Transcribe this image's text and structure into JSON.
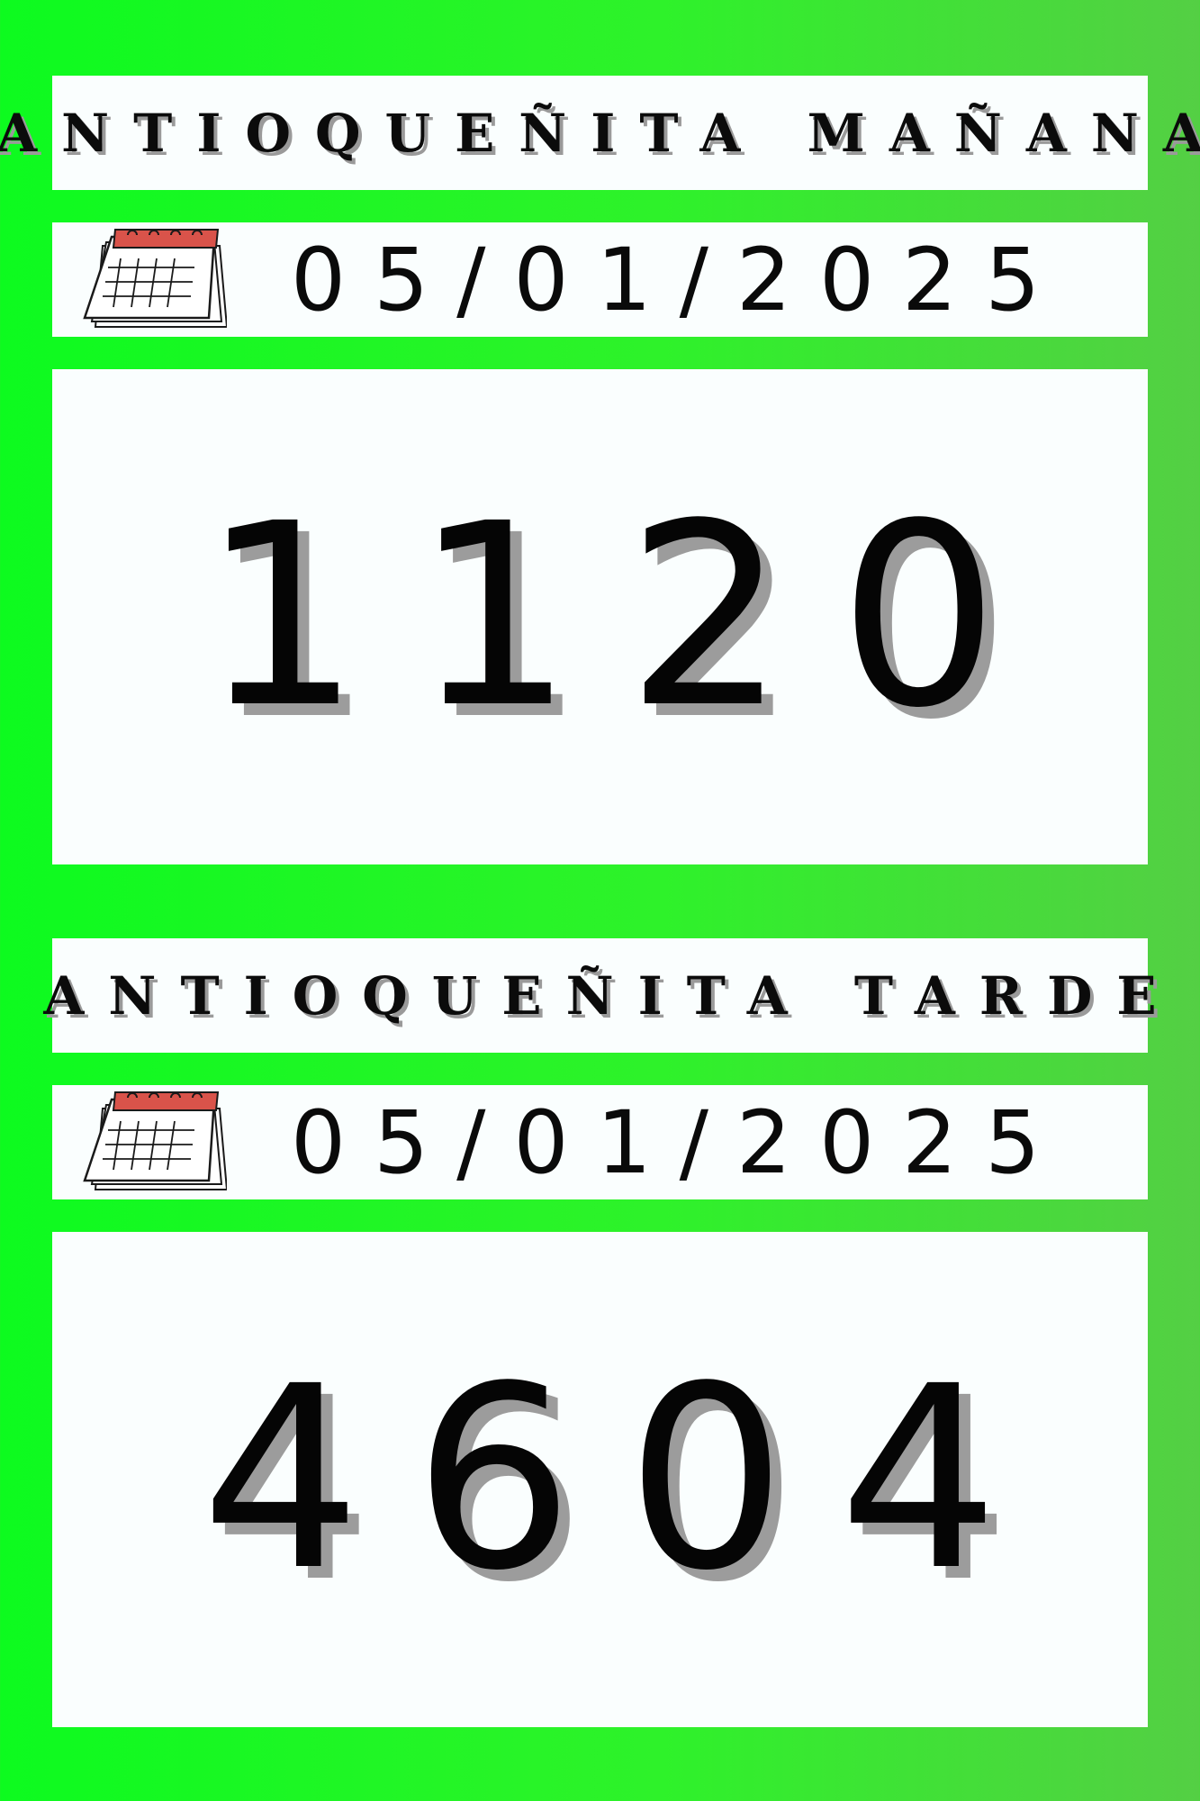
{
  "draws": [
    {
      "title": "ANTIOQUEÑITA MAÑANA",
      "date": "05/01/2025",
      "icon": "calendar-icon",
      "number": "1120"
    },
    {
      "title": "ANTIOQUEÑITA TARDE",
      "date": "05/01/2025",
      "icon": "calendar-icon",
      "number": "4604"
    }
  ],
  "colors": {
    "background_green": "#0dfb1f",
    "panel_white": "#fafefe",
    "calendar_red": "#d9534a",
    "text_black": "#0b0b0b",
    "shadow_gray": "#9c9c9c"
  }
}
